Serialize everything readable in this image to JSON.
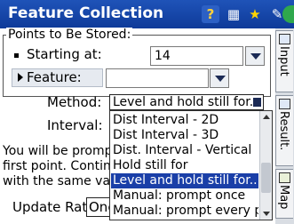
{
  "window": {
    "title": "Feature Collection"
  },
  "toolbar": {
    "help_icon": "question-mark",
    "grid_icon": "grid-table",
    "star_icon": "favorites-star",
    "edit_icon": "edit-document",
    "close_icon": "close-circle"
  },
  "points_group": {
    "legend": "Points to Be Stored:",
    "starting_at_label": "Starting at:",
    "starting_at_value": "14",
    "feature_button_label": "Feature:",
    "feature_value": ""
  },
  "method": {
    "label": "Method:",
    "selected": "Level and hold still for...",
    "options": [
      "Dist Interval - 2D",
      "Dist Interval - 3D",
      "Dist. Interval - Vertical",
      "Hold still for",
      "Level and hold still for...",
      "Manual: prompt once",
      "Manual: prompt every point"
    ],
    "highlighted_index": 4
  },
  "interval": {
    "label": "Interval:"
  },
  "info": {
    "line1": "You will be prompt",
    "line2": "first point. Continu",
    "line3": "with the same valu"
  },
  "update_rate": {
    "label": "Update Rate",
    "value": "One"
  },
  "side_tabs": [
    {
      "label": "Input"
    },
    {
      "label": "Result."
    },
    {
      "label": "Map"
    }
  ],
  "colors": {
    "titlebar": "#1f53b8",
    "selection": "#1a3fa8"
  }
}
